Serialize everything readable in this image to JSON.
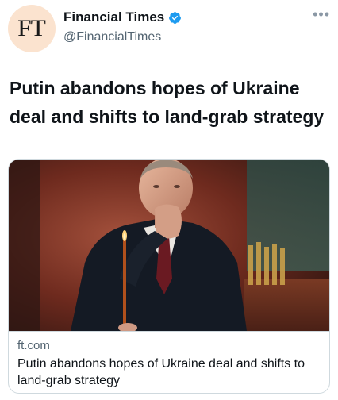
{
  "account": {
    "avatar_text": "FT",
    "display_name": "Financial Times",
    "handle": "@FinancialTimes",
    "verified": true,
    "verified_color": "#1d9bf0",
    "avatar_bg": "#fbe3cf"
  },
  "more_icon": "more-horizontal-icon",
  "tweet": {
    "text": "Putin abandons hopes of Ukraine deal and shifts to land-grab strategy"
  },
  "card": {
    "domain": "ft.com",
    "title": "Putin abandons hopes of Ukraine deal and shifts to land-grab strategy",
    "image_description": "photo of a man in a dark suit holding a thin lit candle, hand on chin, dark red church interior background"
  }
}
